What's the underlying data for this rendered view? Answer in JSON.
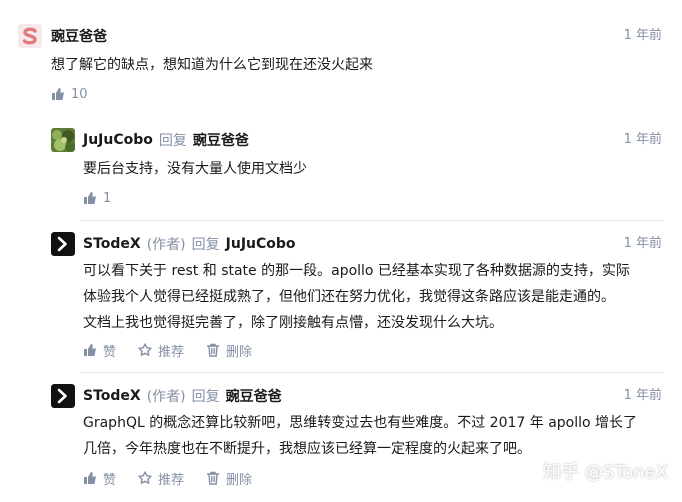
{
  "comments": [
    {
      "author": "豌豆爸爸",
      "time": "1 年前",
      "lines": [
        "想了解它的缺点，想知道为什么它到现在还没火起来"
      ],
      "likes": "10"
    }
  ],
  "replies": [
    {
      "author": "JuJuCobo",
      "reply_word": "回复",
      "target": "豌豆爸爸",
      "time": "1 年前",
      "lines": [
        "要后台支持，没有大量人使用文档少"
      ],
      "likes": "1"
    },
    {
      "author": "STodeX",
      "author_tag": "(作者)",
      "reply_word": "回复",
      "target": "JuJuCobo",
      "time": "1 年前",
      "lines": [
        "可以看下关于 rest 和 state 的那一段。apollo 已经基本实现了各种数据源的支持，实际",
        "体验我个人觉得已经挺成熟了，但他们还在努力优化，我觉得这条路应该是能走通的。",
        "文档上我也觉得挺完善了，除了刚接触有点懵，还没发现什么大坑。"
      ],
      "actions": {
        "like": "赞",
        "recommend": "推荐",
        "delete": "删除"
      }
    },
    {
      "author": "STodeX",
      "author_tag": "(作者)",
      "reply_word": "回复",
      "target": "豌豆爸爸",
      "time": "1 年前",
      "lines": [
        "GraphQL 的概念还算比较新吧，思维转变过去也有些难度。不过 2017 年 apollo 增长了",
        "几倍，今年热度也在不断提升，我想应该已经算一定程度的火起来了吧。"
      ],
      "actions": {
        "like": "赞",
        "recommend": "推荐",
        "delete": "删除"
      }
    }
  ],
  "watermark": "知乎 @STonеX"
}
